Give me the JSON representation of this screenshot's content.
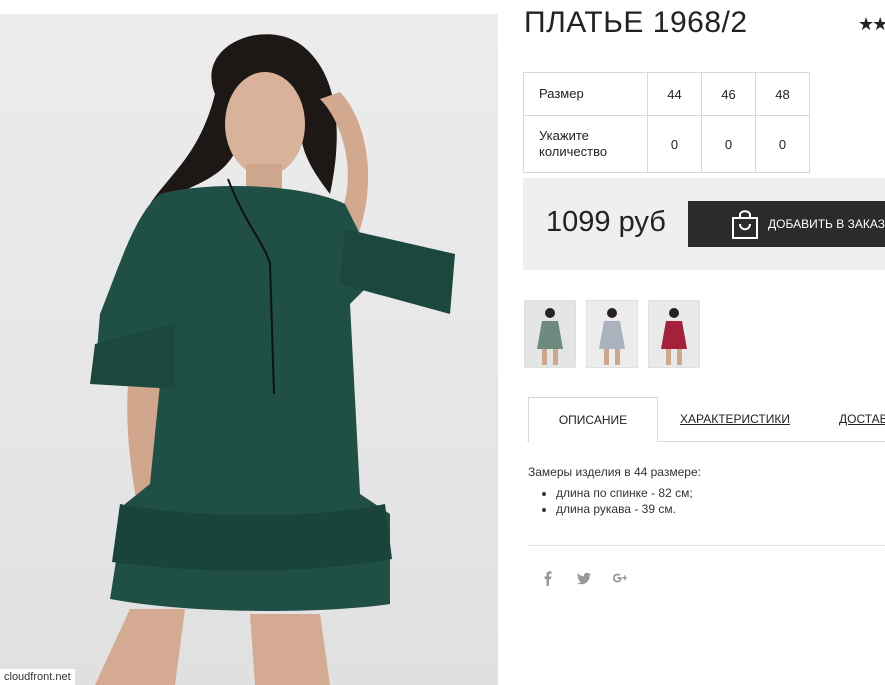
{
  "product": {
    "title": "ПЛАТЬЕ 1968/2",
    "rating_stars": "★★"
  },
  "image": {
    "source_label": "cloudfront.net"
  },
  "sizes": {
    "size_label": "Размер",
    "qty_label": "Укажите количество",
    "values": [
      "44",
      "46",
      "48"
    ],
    "quantities": [
      "0",
      "0",
      "0"
    ]
  },
  "buy": {
    "price": "1099 руб",
    "add_to_cart_label": "ДОБАВИТЬ В ЗАКАЗ",
    "icon": "shopping-bag-icon"
  },
  "thumbnails": [
    {
      "alt": "model in green dress",
      "color": "#6f8a7e"
    },
    {
      "alt": "model in grey dress",
      "color": "#a9b2bd"
    },
    {
      "alt": "model in red dress",
      "color": "#a3213b"
    }
  ],
  "tabs": [
    {
      "label": "ОПИСАНИЕ"
    },
    {
      "label": "ХАРАКТЕРИСТИКИ"
    },
    {
      "label": "ДОСТАВКА"
    }
  ],
  "description": {
    "intro": "Замеры изделия в 44 размере:",
    "items": [
      "длина по спинке - 82 см;",
      "длина рукава - 39 см."
    ]
  },
  "social": [
    {
      "icon": "facebook-icon",
      "glyph": "f"
    },
    {
      "icon": "twitter-icon",
      "glyph": "🐦"
    },
    {
      "icon": "google-plus-icon",
      "glyph": "g+"
    }
  ],
  "colors": {
    "dress": "#1f4f45",
    "button": "#2b2b2b",
    "buy_box": "#efefef"
  }
}
